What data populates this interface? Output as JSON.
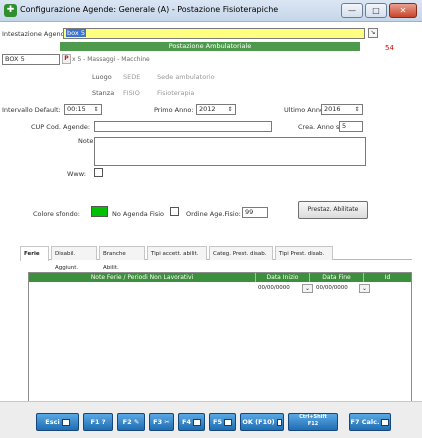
{
  "window": {
    "title": "Configurazione Agende: Generale (A) - Postazione Fisioterapiche",
    "min": "—",
    "max": "□",
    "close": "✕"
  },
  "form": {
    "intestazione_label": "Intestazione Agenda:",
    "intestazione_value": "box 5",
    "postazione_header": "Postazione Ambulatoriale",
    "box_value": "BOX 5",
    "p_label": "P",
    "x5_text": "x 5 - Massaggi - Macchine",
    "luogo_label": "Luogo",
    "luogo_code": "SEDE",
    "luogo_desc": "Sede ambulatorio",
    "stanza_label": "Stanza",
    "stanza_code": "FISIO",
    "stanza_desc": "Fisioterapia",
    "intervallo_label": "Intervallo Default:",
    "intervallo_value": "00:15",
    "primo_anno_label": "Primo Anno:",
    "primo_anno_value": "2012",
    "ultimo_anno_label": "Ultimo Anno:",
    "ultimo_anno_value": "2016",
    "cup_label": "CUP Cod. Agende:",
    "cup_value": "",
    "crea_anno_label": "Crea. Anno succ.:",
    "crea_anno_value": "5",
    "note_label": "Note:",
    "note_value": "",
    "www_label": "Www:",
    "colore_label": "Colore sfondo:",
    "colore_value": "#00c000",
    "no_agenda_label": "No Agenda Fisio",
    "ordine_label": "Ordine Age.Fisio:",
    "ordine_value": "99",
    "prestaz_button": "Prestaz. Abilitate",
    "red_number": "54"
  },
  "tabs": [
    "Ferie",
    "Disabil. Aggiunt.",
    "Branche Abilit.",
    "Tipi accett. abilit.",
    "Categ. Prest. disab.",
    "Tipi Prest. disab."
  ],
  "grid": {
    "columns": [
      "Note   Ferie / Periodi Non Lavorativi",
      "Data Inizio",
      "Data Fine",
      "Id"
    ],
    "row": {
      "inizio": "00/00/0000",
      "fine": "00/00/0000"
    }
  },
  "footer": {
    "esci": "Esci",
    "f1": "F1 ?",
    "f2": "F2",
    "f3": "F3",
    "f4": "F4",
    "f5": "F5",
    "ok": "OK (F10)",
    "shift_top": "Ctrl+Shift",
    "shift_bottom": "F12",
    "f7": "F7 Calc."
  }
}
